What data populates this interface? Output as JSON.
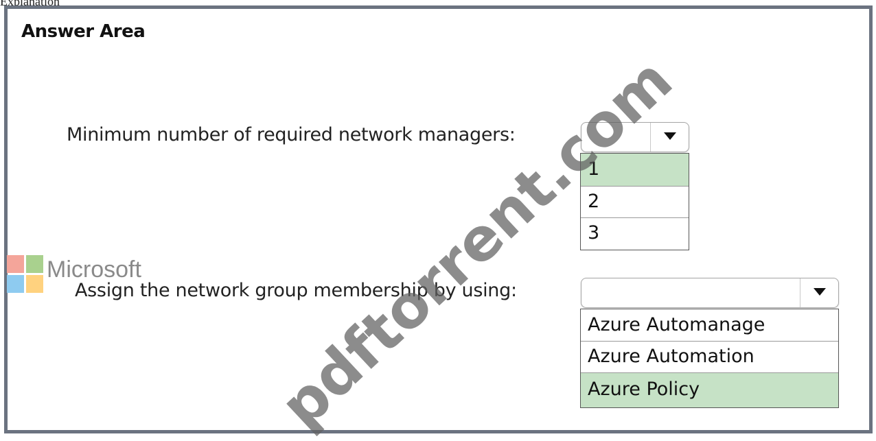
{
  "page_caption": "Explanation",
  "panel": {
    "title": "Answer Area"
  },
  "questions": [
    {
      "label": "Minimum number of required network managers:",
      "selected_value": "",
      "options": [
        "1",
        "2",
        "3"
      ],
      "highlighted_option": "1"
    },
    {
      "label": "Assign the network group membership by using:",
      "selected_value": "",
      "options": [
        "Azure Automanage",
        "Azure Automation",
        "Azure Policy"
      ],
      "highlighted_option": "Azure Policy"
    }
  ],
  "branding": {
    "logo_name": "microsoft-logo",
    "text": "Microsoft",
    "logo_colors": [
      "#f35325",
      "#81bc06",
      "#05a6f0",
      "#ffba08"
    ]
  },
  "watermark": "pdftorrent.com",
  "colors": {
    "panel_border": "#6b7380",
    "selected_option_bg": "#c6e2c6"
  }
}
